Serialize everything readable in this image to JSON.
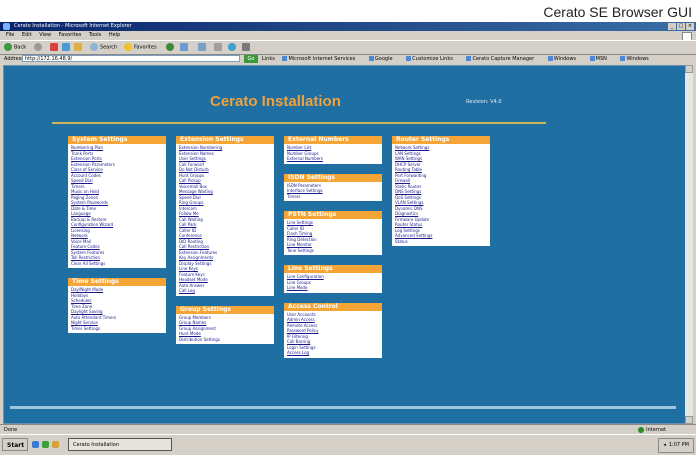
{
  "caption": "Cerato SE Browser GUI",
  "window": {
    "title": "Cerato Installation - Microsoft Internet Explorer"
  },
  "menubar": [
    "File",
    "Edit",
    "View",
    "Favorites",
    "Tools",
    "Help"
  ],
  "toolbar": {
    "back": "Back",
    "search": "Search",
    "favorites": "Favorites"
  },
  "address": {
    "label": "Address",
    "value": "http://172.16.48.9/"
  },
  "go": "Go",
  "links": [
    "Links",
    "Microsoft Internet Services",
    "Google",
    "Customize Links",
    "Cerato Capture Manager",
    "Windows",
    "MSN",
    "Windows"
  ],
  "page": {
    "title": "Cerato Installation",
    "revision": "Revision: V4.0"
  },
  "columns": [
    {
      "menus": [
        {
          "title": "System Settings",
          "items": [
            "Numbering Plan",
            "Trunk Ports",
            "Extension Ports",
            "Extension Parameters",
            "Class of Service",
            "Account Codes",
            "Speed Dial",
            "Timers",
            "Music on Hold",
            "Paging Zones",
            "System Passwords",
            "Date & Time",
            "Language",
            "Backup & Restore",
            "Configuration Wizard",
            "Licensing",
            "Network",
            "Voice Mail",
            "Feature Codes",
            "System Features",
            "Toll Restriction",
            "Clear All Settings"
          ]
        },
        {
          "title": "Time Settings",
          "items": [
            "Day/Night Mode",
            "Holidays",
            "Schedules",
            "Time Zone",
            "Daylight Saving",
            "Auto Attendant Timers",
            "Night Service",
            "Timer Settings"
          ]
        }
      ]
    },
    {
      "menus": [
        {
          "title": "Extension Settings",
          "items": [
            "Extension Numbering",
            "Extension Names",
            "User Settings",
            "Call Forward",
            "Do Not Disturb",
            "Hunt Groups",
            "Call Pickup",
            "Voicemail Box",
            "Message Waiting",
            "Speed Dial",
            "Ring Groups",
            "Intercom",
            "Follow Me",
            "Call Waiting",
            "Call Park",
            "Caller ID",
            "Conference",
            "DID Routing",
            "Call Restriction",
            "Extension Features",
            "Key Assignments",
            "Display Settings",
            "Line Keys",
            "Feature Keys",
            "Headset Mode",
            "Auto Answer",
            "Call Log"
          ]
        },
        {
          "title": "Group Settings",
          "items": [
            "Group Members",
            "Group Names",
            "Group Assignment",
            "Hunt Mode",
            "Distribution Settings"
          ]
        }
      ]
    },
    {
      "menus": [
        {
          "title": "External Numbers",
          "items": [
            "Number List",
            "Number Groups",
            "External Numbers"
          ]
        },
        {
          "title": "ISDN Settings",
          "items": [
            "ISDN Parameters",
            "Interface Settings",
            "Timers"
          ]
        },
        {
          "title": "PSTN Settings",
          "items": [
            "Line Settings",
            "Caller ID",
            "Flash Timing",
            "Ring Detection",
            "Line Monitor",
            "Tone Settings"
          ]
        },
        {
          "title": "Line Settings",
          "items": [
            "Line Configuration",
            "Line Groups",
            "Line Mode"
          ]
        },
        {
          "title": "Access Control",
          "items": [
            "User Accounts",
            "Admin Access",
            "Remote Access",
            "Password Policy",
            "IP Filtering",
            "Call Barring",
            "Login Settings",
            "Access Log"
          ]
        }
      ]
    },
    {
      "menus": [
        {
          "title": "Router Settings",
          "items": [
            "Network Settings",
            "LAN Settings",
            "WAN Settings",
            "DHCP Server",
            "Routing Table",
            "Port Forwarding",
            "Firewall",
            "Static Routes",
            "DNS Settings",
            "QoS Settings",
            "VLAN Settings",
            "Dynamic DNS",
            "Diagnostics",
            "Firmware Update",
            "Router Status",
            "Log Settings",
            "Advanced Settings",
            "Status"
          ]
        }
      ]
    }
  ],
  "statusbar": {
    "left": "Done",
    "zone": "Internet"
  },
  "taskbar": {
    "start": "Start",
    "task": "Cerato Installation",
    "clock": "1:07 PM"
  }
}
